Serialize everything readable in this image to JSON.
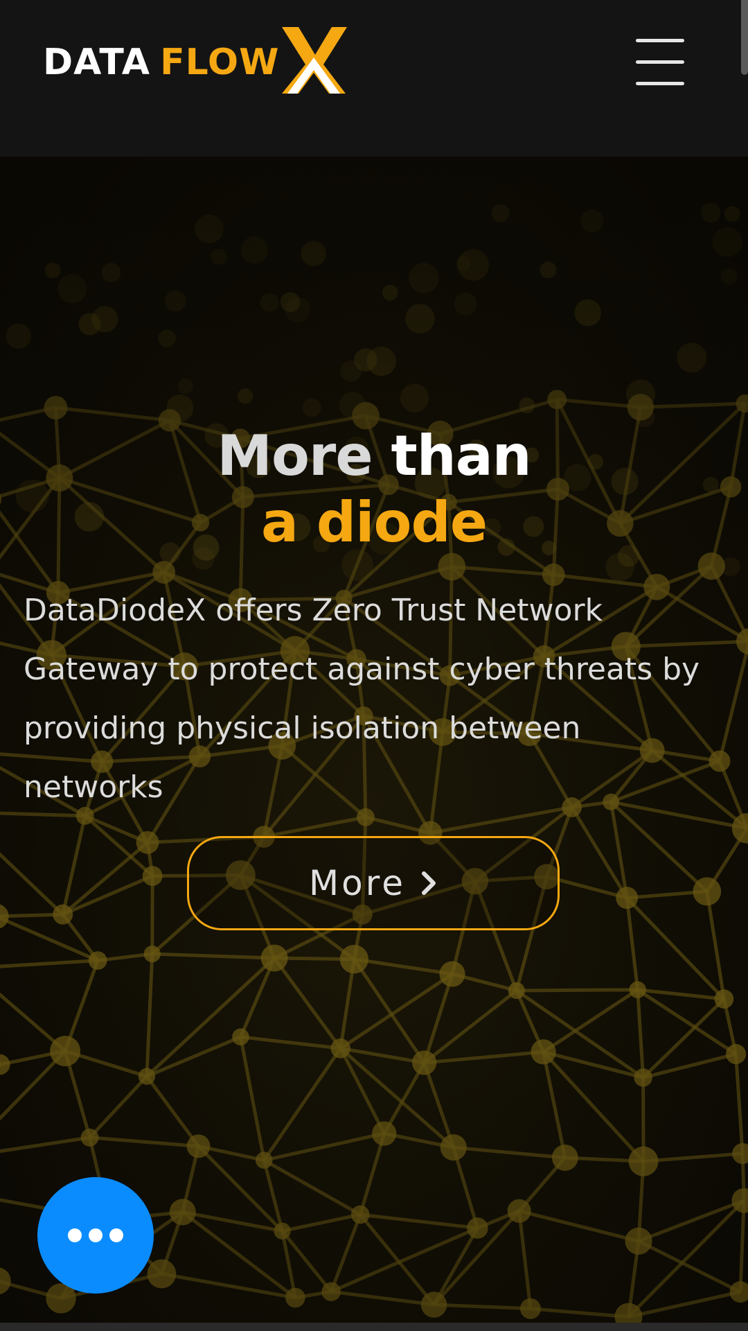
{
  "header": {
    "logo": {
      "word_data": "DATA",
      "word_flow": "FLOW",
      "mark": "X",
      "mark_icon": "x-logo-mark"
    },
    "menu_icon": "hamburger-menu-icon"
  },
  "hero": {
    "headline": {
      "part1": "More",
      "part2": "than",
      "part3": "a diode"
    },
    "description": "DataDiodeX offers Zero Trust Network Gateway to protect against cyber threats by providing physical isolation between networks",
    "cta": {
      "label": "More",
      "icon": "chevron-right-icon"
    },
    "background": "network-mesh-image"
  },
  "chat_widget": {
    "icon": "ellipsis-icon"
  },
  "colors": {
    "accent": "#f5a812",
    "header_bg": "#141414",
    "chat_button": "#0a8cff",
    "text_light": "#dcdcdc"
  }
}
